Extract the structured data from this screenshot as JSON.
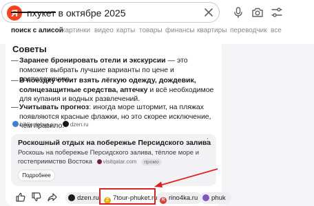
{
  "search": {
    "query": "пхукет в октябре 2025",
    "logo_letter": "Я"
  },
  "header_icons": [
    "clear-icon",
    "microphone-icon",
    "camera-icon",
    "filter-icon"
  ],
  "tabs": [
    {
      "label": "поиск с алисой",
      "active": true
    },
    {
      "label": "картинки"
    },
    {
      "label": "видео"
    },
    {
      "label": "карты"
    },
    {
      "label": "товары"
    },
    {
      "label": "финансы"
    },
    {
      "label": "квартиры"
    },
    {
      "label": "переводчик"
    },
    {
      "label": "все"
    }
  ],
  "answer": {
    "title": "Советы",
    "tips": [
      {
        "bold": "Заранее бронировать отели и экскурсии",
        "rest": " — это поможет выбрать лучшие варианты по цене и расположению."
      },
      {
        "bold": "В поездку стоит взять лёгкую одежду, дождевик, солнцезащитные средства, аптечку",
        "rest": " и всё необходимое для купания и водных развлечений."
      },
      {
        "bold": "Учитывать прогноз",
        "rest": ": иногда море штормит, на пляжах появляются красные флажки, но это скорее исключение, чем правило."
      }
    ],
    "sources": [
      "bibliоglobus.ru",
      "dzen.ru"
    ]
  },
  "ad": {
    "title": "Роскошный отдых на побережье Персидского залива",
    "text": "Роскошь на побережье Персидского залива, тёплое море и гостеприимство Востока",
    "domain": "visitqatar.com",
    "badge": "промо",
    "button": "Подробнее"
  },
  "bottom_chips": [
    {
      "label": "dzen.ru",
      "icon_color": "#1a1a1a"
    },
    {
      "label": "7tour-phuket.ru",
      "icon_color": "#f2a900",
      "icon_text": "Z"
    },
    {
      "label": "rino4ka.ru",
      "icon_color": "#e53935",
      "icon_text": "R"
    },
    {
      "label": "phuk",
      "icon_color": "#7e57c2"
    }
  ],
  "colors": {
    "yandex_red": "#fc3f1d",
    "highlight_red": "#e02020"
  }
}
